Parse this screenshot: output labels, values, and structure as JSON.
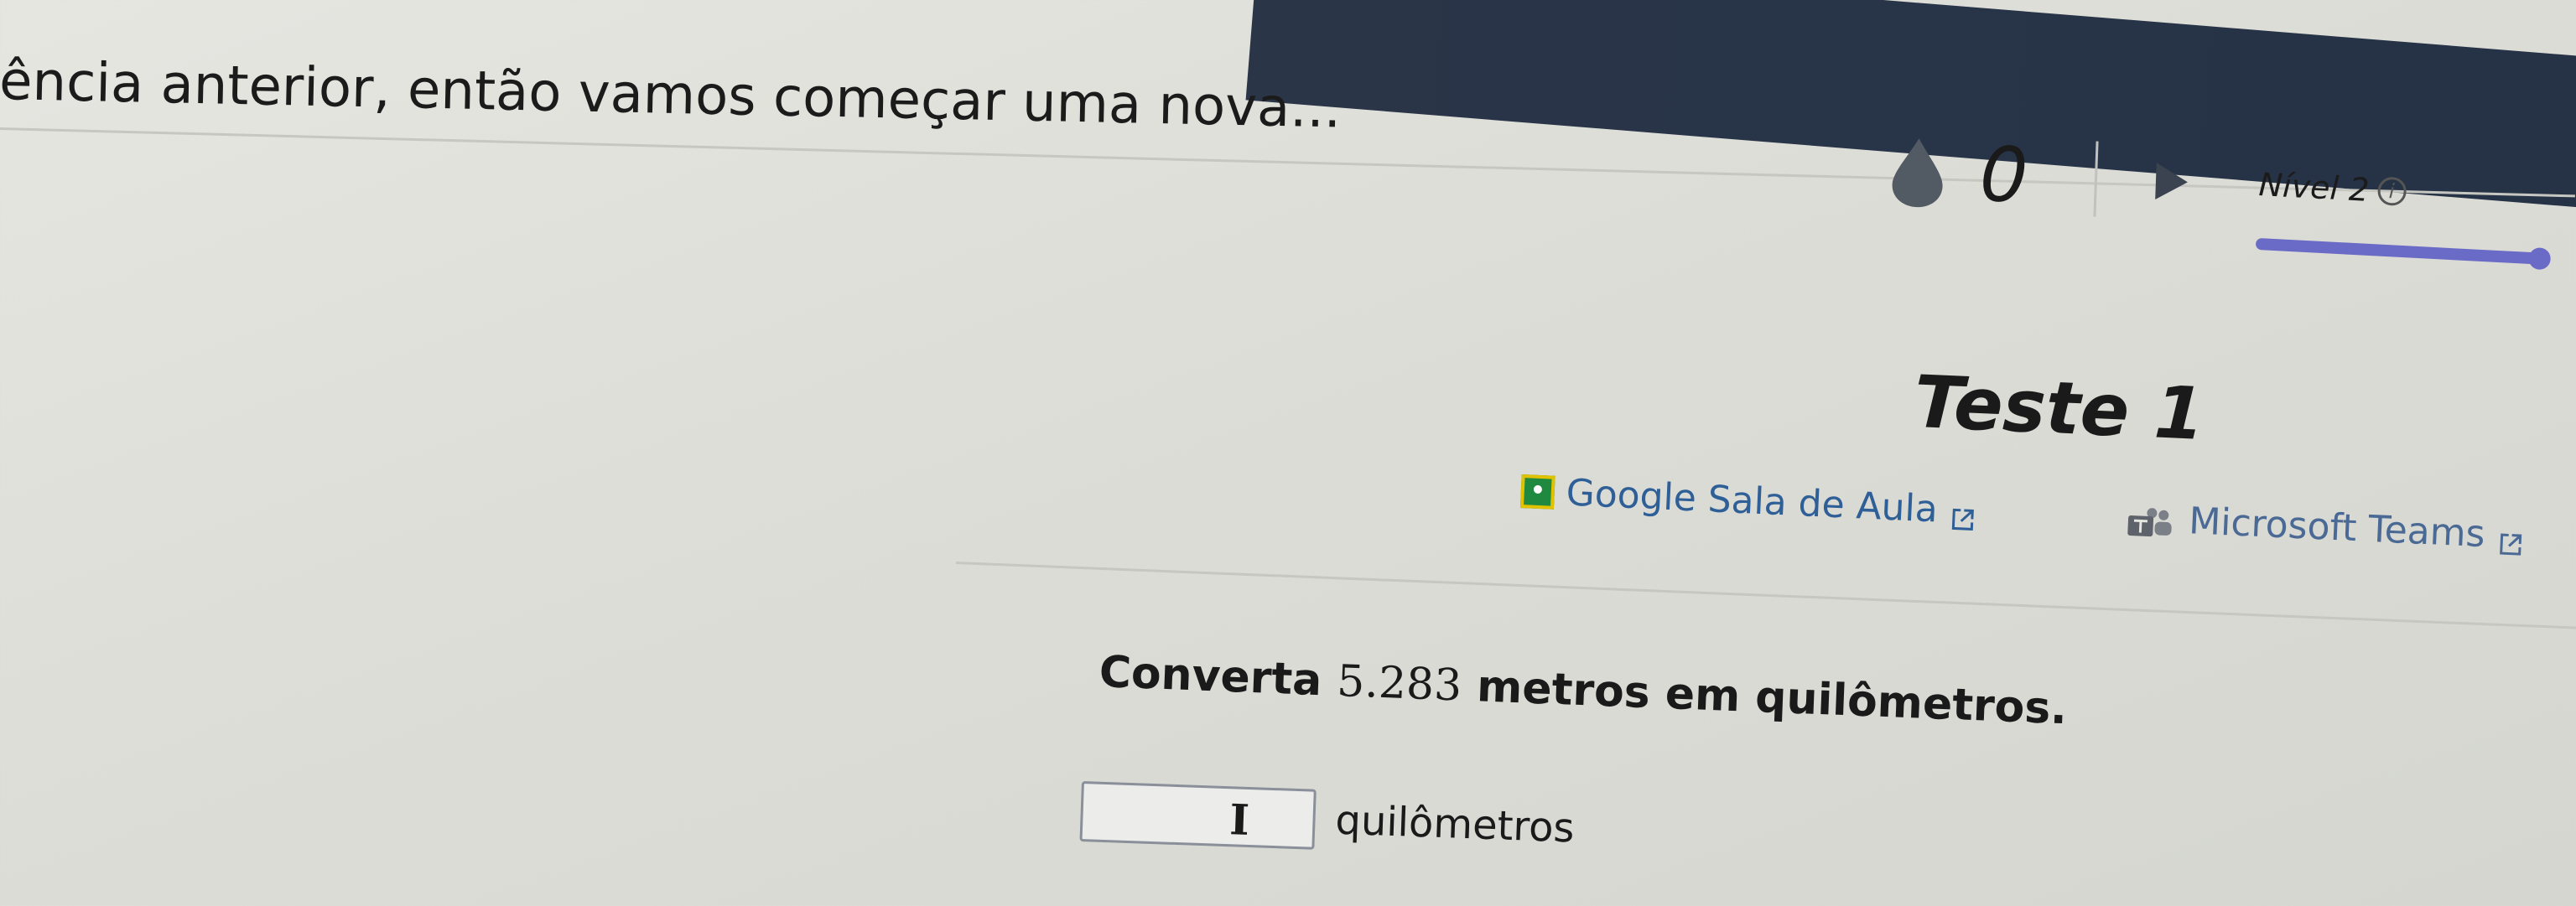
{
  "header": {
    "text": "ência anterior, então vamos começar uma nova..."
  },
  "stats": {
    "streak_count": "0",
    "level_label": "Nível 2",
    "level_progress": 1.0
  },
  "test": {
    "title": "Teste 1"
  },
  "share": {
    "classroom_label": "Google Sala de Aula",
    "teams_label": "Microsoft Teams"
  },
  "question": {
    "prefix": "Converta",
    "value": "5.283",
    "suffix": "metros em quilômetros."
  },
  "answer": {
    "value": "",
    "unit": "quilômetros"
  },
  "colors": {
    "header_band": "#2a3548",
    "level_bar": "#6a6bc6",
    "link": "#2f5f97"
  },
  "icons": [
    "drop-icon",
    "play-icon",
    "info-icon",
    "classroom-icon",
    "teams-icon",
    "external-link-icon",
    "text-cursor-icon"
  ]
}
